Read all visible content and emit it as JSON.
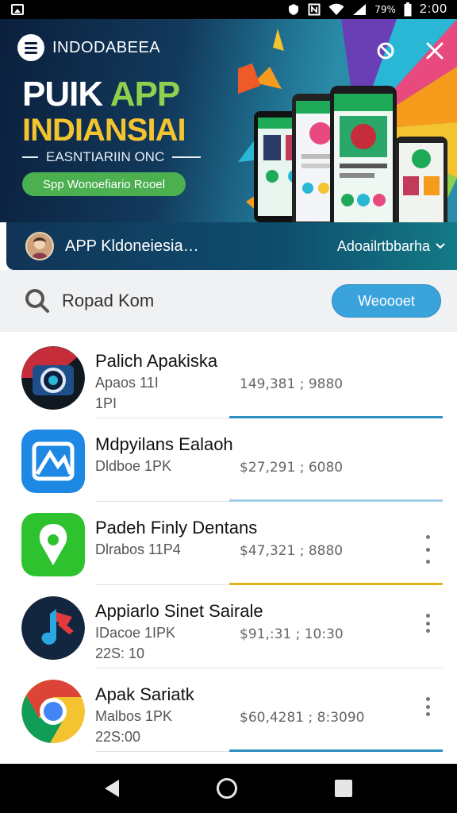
{
  "status_bar": {
    "battery_text": "79%",
    "time": "2:00"
  },
  "hero": {
    "brand_name": "INDODABEEA",
    "title_white": "PUIK ",
    "title_green": "APP",
    "title_line2": "INDIANSIAI",
    "subtitle": "EASNTIARIIN ONC",
    "pill_label": "Spp Wonoefiario Rooel"
  },
  "app_bar": {
    "title": "APP Kldoneiesia…",
    "menu_label": "Adoailrtbbarha"
  },
  "search": {
    "placeholder": "Ropad Kom",
    "button_label": "Weoooet"
  },
  "apps": [
    {
      "name": "Palich Apakiska",
      "sub": "Apaos 11I",
      "sub2": "1PI",
      "stat": "149,381 ; 9880",
      "progress": 1.0,
      "progress_color": "#2c8fc0",
      "has_menu": false
    },
    {
      "name": "Mdpyilans Ealaoh",
      "sub": "Dldboe 1PK",
      "sub2": "",
      "stat": "$27,291 ; 6080",
      "progress": 1.0,
      "progress_color": "#9fcbe6",
      "has_menu": false
    },
    {
      "name": "Padeh Finly Dentans",
      "sub": "Dlrabos 11P4",
      "sub2": "",
      "stat": "$47,321 ; 8880",
      "progress": 1.0,
      "progress_color": "#e0b51c",
      "has_menu": true
    },
    {
      "name": "Appiarlo Sinet Sairale",
      "sub": "IDacoe 1IPK",
      "sub2": "22S: 10",
      "stat": "$91,:31 ; 10:30",
      "progress": 0.0,
      "progress_color": "#2c8fc0",
      "has_menu": true
    },
    {
      "name": "Apak Sariatk",
      "sub": "Malbos 1PK",
      "sub2": "22S:00",
      "stat": "$60,4281 ; 8:3090",
      "progress": 1.0,
      "progress_color": "#2c8fc0",
      "has_menu": true
    }
  ],
  "colors": {
    "accent_blue": "#3aa3dc",
    "hero_green": "#4caf50",
    "hero_yellow": "#f4c430"
  }
}
